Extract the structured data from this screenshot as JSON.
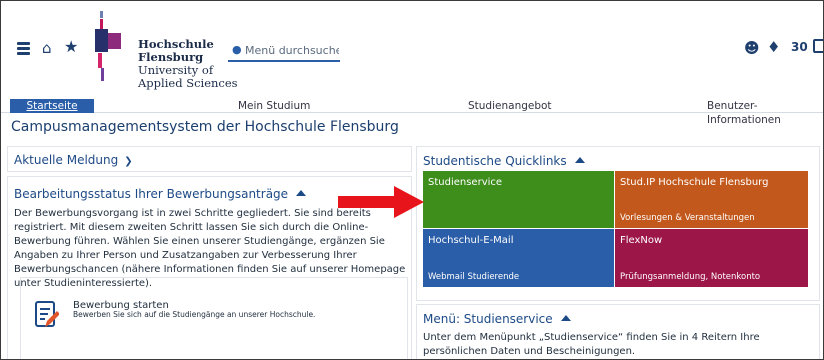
{
  "header": {
    "logo_lines": [
      "Hochschule",
      "Flensburg",
      "University of",
      "Applied Sciences"
    ],
    "search_placeholder": "Menü durchsuchen",
    "notification_count": "30"
  },
  "nav": {
    "items": [
      "Startseite",
      "Mein Studium",
      "Studienangebot",
      "Benutzer-Informationen"
    ]
  },
  "page_title": "Campusmanagementsystem der Hochschule Flensburg",
  "left": {
    "news_title": "Aktuelle Meldung",
    "status_title": "Bearbeitungsstatus Ihrer Bewerbungsanträge",
    "status_text": "Der Bewerbungsvorgang ist in zwei Schritte gegliedert. Sie sind bereits registriert. Mit diesem zweiten Schritt lassen Sie sich durch die Online-Bewerbung führen. Wählen Sie einen unserer Studiengänge, ergänzen Sie Angaben zu Ihrer Person und Zusatzangaben zur Verbesserung Ihrer Bewerbungschancen (nähere Informationen finden Sie auf unserer Homepage unter Studieninteressierte).",
    "apply_title": "Bewerbung starten",
    "apply_sub": "Bewerben Sie sich auf die Studiengänge an unserer Hochschule."
  },
  "right": {
    "quicklinks_title": "Studentische Quicklinks",
    "tiles": [
      {
        "title": "Studienservice",
        "sub": ""
      },
      {
        "title": "Stud.IP Hochschule Flensburg",
        "sub": "Vorlesungen & Veranstaltungen"
      },
      {
        "title": "Hochschul-E-Mail",
        "sub": "Webmail Studierende"
      },
      {
        "title": "FlexNow",
        "sub": "Prüfungsanmeldung, Notenkonto"
      }
    ],
    "menu_title": "Menü: Studienservice",
    "menu_text": "Unter dem Menüpunkt „Studienservice“ finden Sie in 4 Reitern Ihre persönlichen Daten und Bescheinigungen."
  },
  "colors": {
    "tile_green": "#3e8e1c",
    "tile_orange": "#c2581b",
    "tile_blue": "#2a5ea8",
    "tile_red": "#9c1648",
    "accent": "#2a5ea8",
    "arrow": "#e8141b"
  }
}
